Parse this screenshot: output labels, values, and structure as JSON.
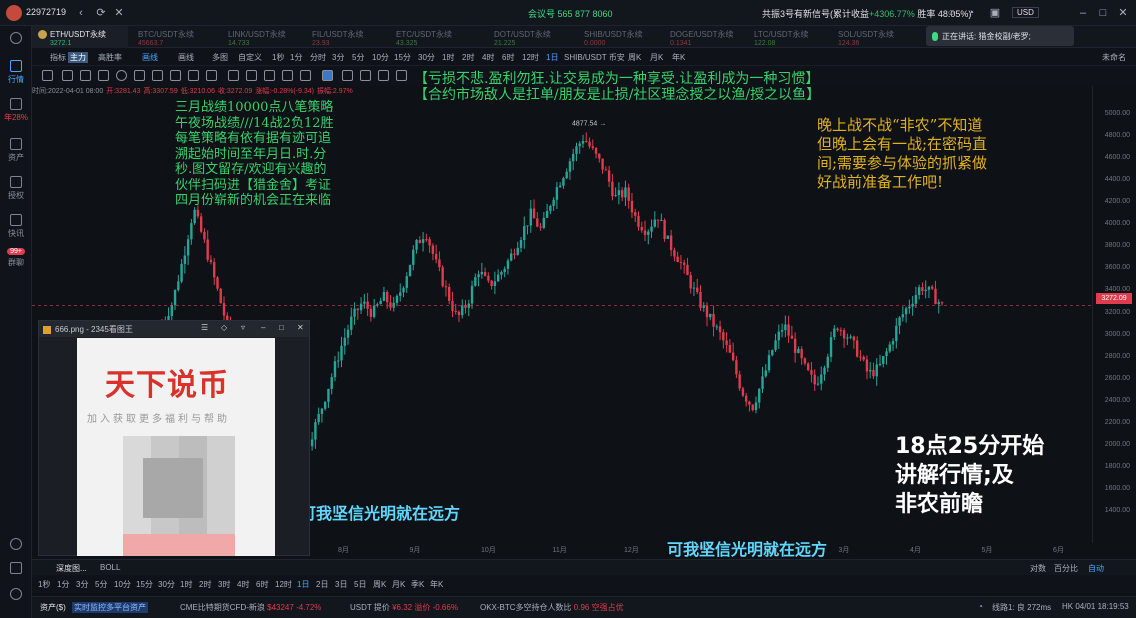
{
  "titlebar": {
    "account": "22972719",
    "meeting": "会议号 565 877 8060",
    "announcement": "共振3号有新信号(累计收益",
    "gain": "+4306.77%",
    "winrate": "胜率 48.05%)",
    "currency": "USD"
  },
  "rail": {
    "items": [
      {
        "label": "行情"
      },
      {
        "label": "年28%"
      },
      {
        "label": "资产"
      },
      {
        "label": "授权"
      },
      {
        "label": "快讯"
      },
      {
        "label": "群聊"
      }
    ],
    "badge": "99+"
  },
  "tabs": [
    {
      "label": "ETH/USDT永续",
      "price": "3272.1"
    },
    {
      "label": "BTC/USDT永续",
      "price": "45663.7"
    },
    {
      "label": "LINK/USDT永续",
      "price": "14.733"
    },
    {
      "label": "FIL/USDT永续",
      "price": "23.93"
    },
    {
      "label": "ETC/USDT永续",
      "price": "43.325"
    },
    {
      "label": "DOT/USDT永续",
      "price": "21.225"
    },
    {
      "label": "SHIB/USDT永续",
      "price": "0.0000"
    },
    {
      "label": "DOGE/USDT永续",
      "price": "0.1341"
    },
    {
      "label": "LTC/USDT永续",
      "price": "122.08"
    },
    {
      "label": "SOL/USDT永续",
      "price": "124.36"
    }
  ],
  "popup": {
    "text": "正在讲话: 猎金校副/老罗;"
  },
  "row1": {
    "items": [
      "指标",
      "主力",
      "高胜率",
      "画线",
      "画线",
      "多图",
      "自定义",
      "1秒",
      "1分",
      "分时",
      "3分",
      "5分",
      "10分",
      "15分",
      "30分",
      "1时",
      "2时",
      "4时",
      "6时",
      "12时",
      "1日",
      "SHIB/USDT 币安",
      "周K",
      "月K",
      "年K"
    ],
    "right": "未命名"
  },
  "ohlc": {
    "time": "时间:2022-04-01 08:00",
    "open": "开:3281.43",
    "high": "高:3307.59",
    "low": "低:3210.06",
    "close": "收:3272.09",
    "change": "涨幅:-0.28%(-9.34)",
    "amp": "振幅:2.97%"
  },
  "chart_data": {
    "type": "candlestick",
    "symbol": "ETH/USDT永续",
    "ylim": [
      1300,
      5100
    ],
    "yticks": [
      5000,
      4800,
      4600,
      4400,
      4200,
      4000,
      3800,
      3600,
      3400,
      3200,
      3000,
      2800,
      2600,
      2400,
      2200,
      2000,
      1800,
      1600,
      1400
    ],
    "xticks": [
      "8月",
      "9月",
      "10月",
      "11月",
      "12月",
      "2022",
      "2月",
      "3月",
      "4月",
      "5月",
      "6月"
    ],
    "high_label": "4877.54",
    "last_price": "3272.09",
    "series_path": [
      3100,
      3300,
      3700,
      4150,
      3850,
      3500,
      3150,
      2800,
      2450,
      2250,
      2000,
      1850,
      1750,
      1900,
      2050,
      2300,
      2600,
      2900,
      3150,
      3300,
      3200,
      3350,
      3250,
      3500,
      3800,
      3950,
      3650,
      3400,
      3150,
      3300,
      3600,
      3450,
      3550,
      3700,
      3900,
      4100,
      3950,
      4250,
      4450,
      4650,
      4800,
      4650,
      4500,
      4250,
      4300,
      4050,
      3950,
      4100,
      3850,
      3700,
      3500,
      3300,
      3150,
      3000,
      2800,
      2500,
      2350,
      2600,
      2900,
      3100,
      2900,
      2700,
      2550,
      2800,
      3100,
      3000,
      2850,
      2650,
      2700,
      2900,
      3150,
      3300,
      3450,
      3380,
      3272
    ]
  },
  "overlays": {
    "banner1": "【亏损不悲.盈利勿狂.让交易成为一种享受.让盈利成为一种习惯】",
    "banner2": "【合约市场敌人是扛单/朋友是止损/社区理念授之以渔/授之以鱼】",
    "left_block": [
      "三月战绩10000点八笔策略",
      "午夜场战绩///14战2负12胜",
      "每笔策略有依有据有迹可追",
      "溯起始时间至年月日.时.分",
      "秒.图文留存/欢迎有兴趣的",
      "伙伴扫码进【猎金舍】考证",
      "四月份崭新的机会正在来临"
    ],
    "right_block": [
      "晚上战不战“非农”不知道",
      "但晚上会有一战;在密码直",
      "间;需要参与体验的抓紧做",
      "好战前准备工作吧!"
    ],
    "bottom_right": [
      "18点25分开始",
      "讲解行情;及",
      "非农前瞻"
    ],
    "slogan1": "可我坚信光明就在远方",
    "slogan2": "可我坚信光明就在远方"
  },
  "viewer": {
    "title": "666.png - 2345看图王",
    "brand": "天下说币",
    "brand_sub": "加入获取更多福利与帮助"
  },
  "subbar": {
    "left": "深度图...",
    "indicator": "BOLL",
    "right1": "对数",
    "right2": "百分比",
    "right3": "自动"
  },
  "tfbar": [
    "1秒",
    "1分",
    "3分",
    "5分",
    "10分",
    "15分",
    "30分",
    "1时",
    "2时",
    "3时",
    "4时",
    "6时",
    "12时",
    "1日",
    "2日",
    "3日",
    "5日",
    "周K",
    "月K",
    "季K",
    "年K"
  ],
  "statusbar": {
    "asset": "资产($)",
    "live": "实时监控多平台资产",
    "ticker1": "CME比特期货CFD-新浪",
    "t1val": "$43247",
    "t1chg": "-4.72%",
    "ticker2": "USDT 提价",
    "t2val": "¥6.32",
    "t2chg": "溢价 -0.66%",
    "ticker3": "OKX-BTC多空持仓人数比",
    "t3val": "0.96",
    "t3chg": "空强占优",
    "line": "线路1: 良 272ms",
    "clock": "HK 04/01 18:19:53"
  },
  "colors": {
    "up": "#26a69a",
    "down": "#e03b4e",
    "accent": "#4ea3ff"
  }
}
